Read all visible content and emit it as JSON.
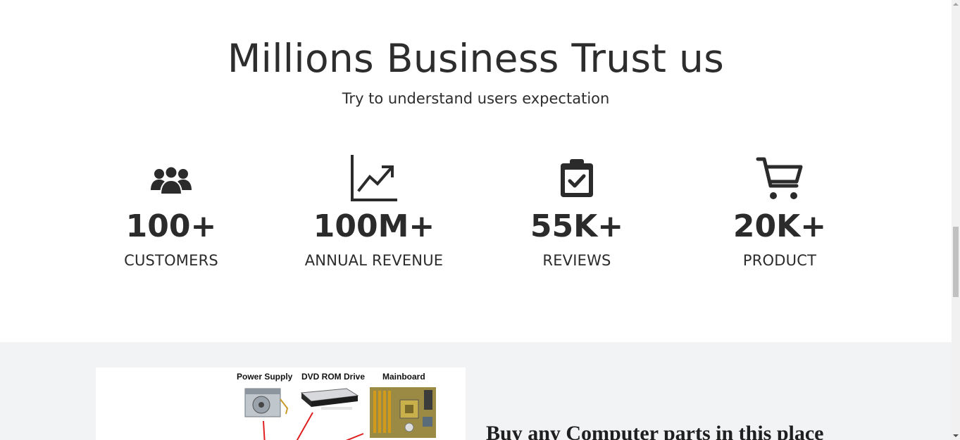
{
  "trust": {
    "title": "Millions Business Trust us",
    "subtitle": "Try to understand users expectation",
    "stats": [
      {
        "icon": "users-icon",
        "value": "100+",
        "label": "CUSTOMERS"
      },
      {
        "icon": "chart-line-icon",
        "value": "100M+",
        "label": "ANNUAL REVENUE"
      },
      {
        "icon": "clipboard-check-icon",
        "value": "55K+",
        "label": "REVIEWS"
      },
      {
        "icon": "shopping-cart-icon",
        "value": "20K+",
        "label": "PRODUCT"
      }
    ]
  },
  "parts": {
    "image_labels": [
      "Power Supply",
      "DVD ROM Drive",
      "Mainboard"
    ],
    "heading": "Buy any Computer parts in this place"
  },
  "colors": {
    "text": "#2b2b2b",
    "section_bg": "#f2f3f5",
    "scroll_thumb": "#c1c1c1"
  }
}
